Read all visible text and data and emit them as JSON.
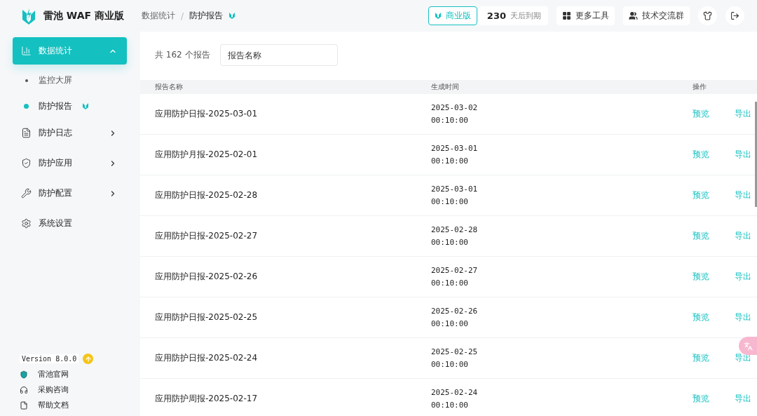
{
  "header": {
    "brand": "雷池 WAF 商业版",
    "breadcrumb": [
      "数据统计",
      "防护报告"
    ],
    "separator": "/",
    "edition": "商业版",
    "days": "230",
    "days_label": "天后到期",
    "tools": [
      {
        "kind": "grid",
        "label": "更多工具"
      },
      {
        "kind": "group",
        "label": "技术交流群"
      }
    ]
  },
  "sidebar": {
    "items": [
      {
        "kind": "chart",
        "label": "数据统计",
        "selected": true,
        "expanded": true,
        "children": [
          {
            "label": "监控大屏",
            "selected": false
          },
          {
            "label": "防护报告",
            "selected": true
          }
        ]
      },
      {
        "kind": "log",
        "label": "防护日志",
        "selected": false,
        "expanded": false
      },
      {
        "kind": "shield",
        "label": "防护应用",
        "selected": false,
        "expanded": false
      },
      {
        "kind": "tools",
        "label": "防护配置",
        "selected": false,
        "expanded": false
      },
      {
        "kind": "gear",
        "label": "系统设置",
        "selected": false
      }
    ],
    "version": "Version 8.0.0",
    "links": [
      {
        "kind": "site",
        "label": "雷池官网"
      },
      {
        "kind": "headset",
        "label": "采购咨询"
      },
      {
        "kind": "doc",
        "label": "帮助文档"
      }
    ]
  },
  "content": {
    "count": "共 162 个报告",
    "search": {
      "placeholder": "报告名称"
    },
    "table": {
      "columns": [
        "报告名称",
        "生成时间",
        "操作"
      ],
      "rows": [
        {
          "name": "应用防护日报-2025-03-01",
          "date": "2025-03-02",
          "time": "00:10:00",
          "actions": [
            "预览",
            "导出"
          ]
        },
        {
          "name": "应用防护月报-2025-02-01",
          "date": "2025-03-01",
          "time": "00:10:00",
          "actions": [
            "预览",
            "导出"
          ]
        },
        {
          "name": "应用防护日报-2025-02-28",
          "date": "2025-03-01",
          "time": "00:10:00",
          "actions": [
            "预览",
            "导出"
          ]
        },
        {
          "name": "应用防护日报-2025-02-27",
          "date": "2025-02-28",
          "time": "00:10:00",
          "actions": [
            "预览",
            "导出"
          ]
        },
        {
          "name": "应用防护日报-2025-02-26",
          "date": "2025-02-27",
          "time": "00:10:00",
          "actions": [
            "预览",
            "导出"
          ]
        },
        {
          "name": "应用防护日报-2025-02-25",
          "date": "2025-02-26",
          "time": "00:10:00",
          "actions": [
            "预览",
            "导出"
          ]
        },
        {
          "name": "应用防护日报-2025-02-24",
          "date": "2025-02-25",
          "time": "00:10:00",
          "actions": [
            "预览",
            "导出"
          ]
        },
        {
          "name": "应用防护周报-2025-02-17",
          "date": "2025-02-24",
          "time": "00:10:00",
          "actions": [
            "预览",
            "导出"
          ]
        }
      ]
    }
  }
}
